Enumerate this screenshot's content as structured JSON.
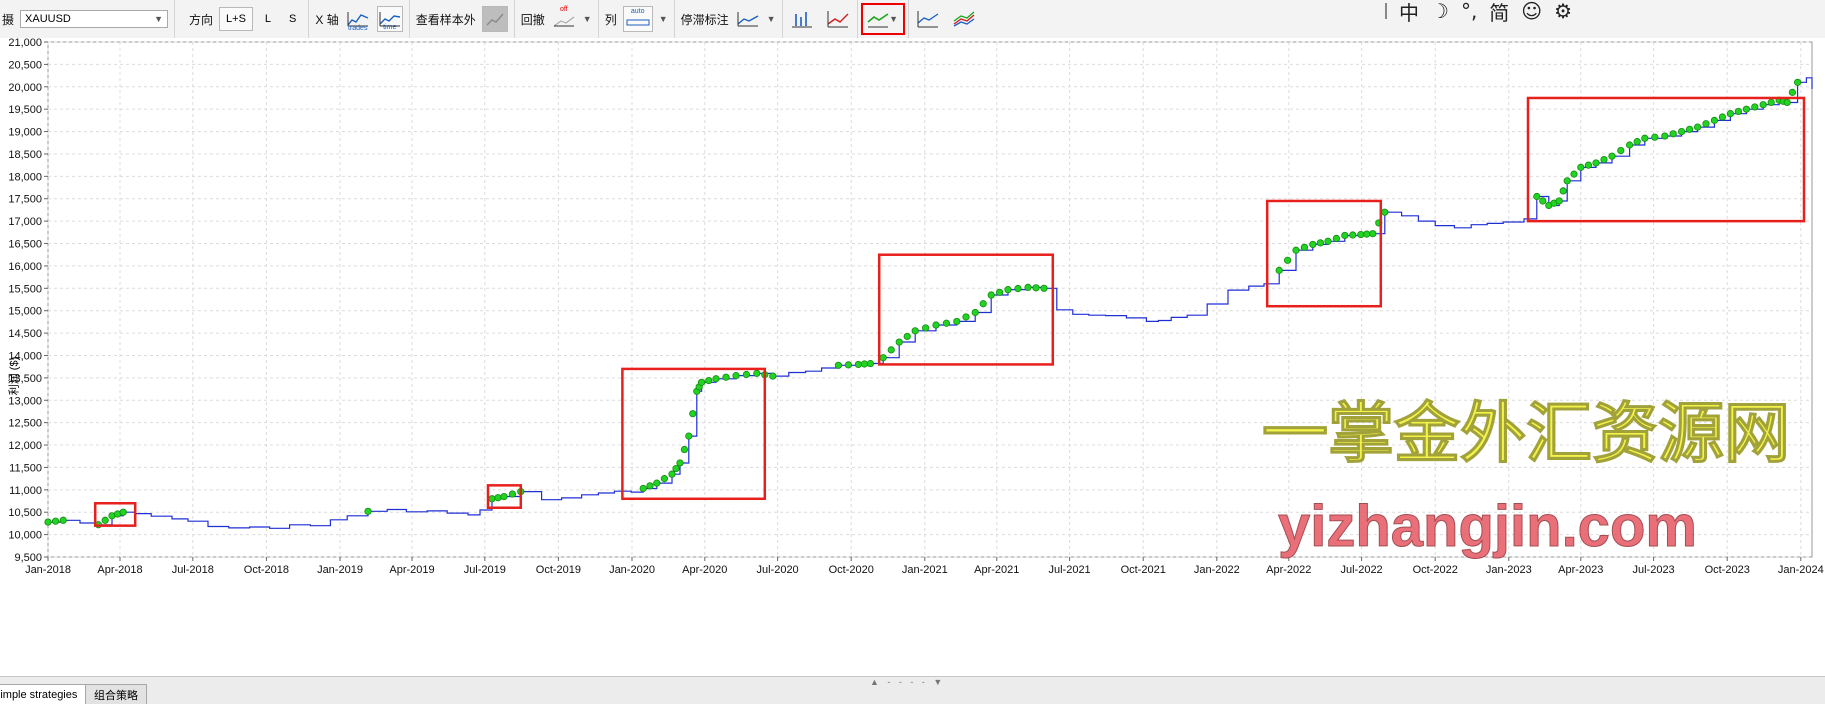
{
  "toolbar": {
    "symbol_prefix": "摄",
    "symbol_value": "XAUUSD",
    "direction_label": "方向",
    "direction_options": [
      "L+S",
      "L",
      "S"
    ],
    "xaxis_label": "X 轴",
    "xaxis_options": [
      "trades",
      "time"
    ],
    "oos_label": "查看样本外",
    "drawdown_label": "回撤",
    "drawdown_state": "off",
    "columns_label": "列",
    "columns_state": "auto",
    "stop_label": "停滞标注"
  },
  "sysbar": {
    "lang": "中",
    "moon": "☽",
    "dot": "°,",
    "simp": "简",
    "smile": "☺",
    "gear": "⚙"
  },
  "chart_data": {
    "type": "line",
    "ylabel": "利润 ($)",
    "ylim": [
      9500,
      21000
    ],
    "yticks": [
      9500,
      10000,
      10500,
      11000,
      11500,
      12000,
      12500,
      13000,
      13500,
      14000,
      14500,
      15000,
      15500,
      16000,
      16500,
      17000,
      17500,
      18000,
      18500,
      19000,
      19500,
      20000,
      20500,
      21000
    ],
    "ytick_labels": [
      "9,500",
      "10,000",
      "10,500",
      "11,000",
      "11,500",
      "12,000",
      "12,500",
      "13,000",
      "13,500",
      "14,000",
      "14,500",
      "15,000",
      "15,500",
      "16,000",
      "16,500",
      "17,000",
      "17,500",
      "18,000",
      "18,500",
      "19,000",
      "19,500",
      "20,000",
      "20,500",
      "21,000"
    ],
    "xlim": [
      "2018-01-01",
      "2024-01-15"
    ],
    "xticks": [
      "2018-01-01",
      "2018-04-01",
      "2018-07-01",
      "2018-10-01",
      "2019-01-01",
      "2019-04-01",
      "2019-07-01",
      "2019-10-01",
      "2020-01-01",
      "2020-04-01",
      "2020-07-01",
      "2020-10-01",
      "2021-01-01",
      "2021-04-01",
      "2021-07-01",
      "2021-10-01",
      "2022-01-01",
      "2022-04-01",
      "2022-07-01",
      "2022-10-01",
      "2023-01-01",
      "2023-04-01",
      "2023-07-01",
      "2023-10-01",
      "2024-01-01"
    ],
    "xtick_labels": [
      "Jan-2018",
      "Apr-2018",
      "Jul-2018",
      "Oct-2018",
      "Jan-2019",
      "Apr-2019",
      "Jul-2019",
      "Oct-2019",
      "Jan-2020",
      "Apr-2020",
      "Jul-2020",
      "Oct-2020",
      "Jan-2021",
      "Apr-2021",
      "Jul-2021",
      "Oct-2021",
      "Jan-2022",
      "Apr-2022",
      "Jul-2022",
      "Oct-2022",
      "Jan-2023",
      "Apr-2023",
      "Jul-2023",
      "Oct-2023",
      "Jan-2024"
    ],
    "grid": true,
    "line_color": "#1f2fd6",
    "marker_color": "#22d422",
    "box_color": "#e8201c",
    "series": [
      {
        "x": [
          "2018-01-01",
          "2018-01-20",
          "2018-02-10",
          "2018-03-05",
          "2018-03-22",
          "2018-04-05",
          "2018-04-20",
          "2018-05-10",
          "2018-06-05",
          "2018-06-25",
          "2018-07-20",
          "2018-08-15",
          "2018-09-10",
          "2018-10-05",
          "2018-10-30",
          "2018-11-25",
          "2018-12-20",
          "2019-01-10",
          "2019-02-05",
          "2019-03-01",
          "2019-03-25",
          "2019-04-20",
          "2019-05-15",
          "2019-06-10",
          "2019-06-25",
          "2019-07-10",
          "2019-07-25",
          "2019-08-15",
          "2019-09-10",
          "2019-10-05",
          "2019-10-30",
          "2019-11-20",
          "2019-12-10",
          "2019-12-31",
          "2020-01-15",
          "2020-02-01",
          "2020-02-20",
          "2020-03-01",
          "2020-03-12",
          "2020-03-22",
          "2020-03-28",
          "2020-04-15",
          "2020-05-10",
          "2020-06-05",
          "2020-06-25",
          "2020-07-15",
          "2020-08-05",
          "2020-08-25",
          "2020-09-15",
          "2020-10-10",
          "2020-10-25",
          "2020-11-10",
          "2020-11-30",
          "2020-12-20",
          "2021-01-15",
          "2021-02-10",
          "2021-03-05",
          "2021-03-25",
          "2021-04-15",
          "2021-05-10",
          "2021-05-30",
          "2021-06-15",
          "2021-07-05",
          "2021-07-25",
          "2021-08-15",
          "2021-09-10",
          "2021-10-05",
          "2021-10-20",
          "2021-11-05",
          "2021-11-25",
          "2021-12-20",
          "2022-01-15",
          "2022-02-10",
          "2022-03-01",
          "2022-03-20",
          "2022-04-10",
          "2022-05-01",
          "2022-05-20",
          "2022-06-10",
          "2022-06-30",
          "2022-07-15",
          "2022-07-30",
          "2022-08-20",
          "2022-09-10",
          "2022-10-01",
          "2022-10-25",
          "2022-11-15",
          "2022-12-05",
          "2022-12-25",
          "2023-01-20",
          "2023-02-05",
          "2023-02-20",
          "2023-03-05",
          "2023-03-15",
          "2023-04-01",
          "2023-04-20",
          "2023-05-10",
          "2023-06-01",
          "2023-06-20",
          "2023-07-15",
          "2023-08-05",
          "2023-08-25",
          "2023-09-15",
          "2023-10-05",
          "2023-10-25",
          "2023-11-15",
          "2023-12-05",
          "2023-12-15",
          "2023-12-28",
          "2024-01-08",
          "2024-01-15"
        ],
        "y": [
          10280,
          10320,
          10260,
          10220,
          10420,
          10500,
          10470,
          10410,
          10350,
          10300,
          10180,
          10150,
          10170,
          10140,
          10220,
          10200,
          10330,
          10420,
          10520,
          10560,
          10510,
          10530,
          10480,
          10440,
          10550,
          10800,
          10850,
          10960,
          10780,
          10820,
          10890,
          10930,
          10970,
          10950,
          11030,
          11150,
          11350,
          11600,
          12200,
          13200,
          13400,
          13480,
          13550,
          13600,
          13540,
          13620,
          13650,
          13720,
          13780,
          13800,
          13820,
          13950,
          14300,
          14550,
          14680,
          14760,
          14960,
          15350,
          15470,
          15520,
          15500,
          15020,
          14920,
          14900,
          14890,
          14840,
          14760,
          14780,
          14850,
          14900,
          15150,
          15460,
          15550,
          15600,
          15900,
          16350,
          16480,
          16550,
          16680,
          16700,
          16720,
          17200,
          17120,
          17000,
          16900,
          16850,
          16920,
          16950,
          16980,
          17050,
          17550,
          17350,
          17450,
          17900,
          18200,
          18300,
          18450,
          18700,
          18850,
          18900,
          19000,
          19100,
          19250,
          19400,
          19500,
          19600,
          19700,
          19650,
          20100,
          20200,
          19950
        ]
      }
    ],
    "highlight_ranges": [
      [
        "2018-01-01",
        "2018-01-20"
      ],
      [
        "2018-03-05",
        "2018-04-05"
      ],
      [
        "2019-02-05",
        "2019-02-05"
      ],
      [
        "2019-07-10",
        "2019-08-15"
      ],
      [
        "2020-01-01",
        "2020-06-25"
      ],
      [
        "2020-09-15",
        "2020-10-25"
      ],
      [
        "2020-11-10",
        "2021-05-30"
      ],
      [
        "2022-03-20",
        "2022-07-30"
      ],
      [
        "2023-02-05",
        "2023-12-28"
      ]
    ],
    "boxes": [
      {
        "x0": "2018-03-01",
        "x1": "2018-04-20",
        "y0": 10200,
        "y1": 10700
      },
      {
        "x0": "2019-07-05",
        "x1": "2019-08-15",
        "y0": 10600,
        "y1": 11100
      },
      {
        "x0": "2019-12-20",
        "x1": "2020-06-15",
        "y0": 10800,
        "y1": 13700
      },
      {
        "x0": "2020-11-05",
        "x1": "2021-06-10",
        "y0": 13800,
        "y1": 16250
      },
      {
        "x0": "2022-03-05",
        "x1": "2022-07-25",
        "y0": 15100,
        "y1": 17450
      },
      {
        "x0": "2023-01-25",
        "x1": "2024-01-05",
        "y0": 17000,
        "y1": 19750
      }
    ]
  },
  "watermark": {
    "line1": "一掌金外汇资源网",
    "line1_color": "#f2f23a",
    "line2": "yizhangjin.com",
    "line2_color": "#e8636e"
  },
  "tabs": [
    "Simple strategies",
    "组合策略"
  ]
}
